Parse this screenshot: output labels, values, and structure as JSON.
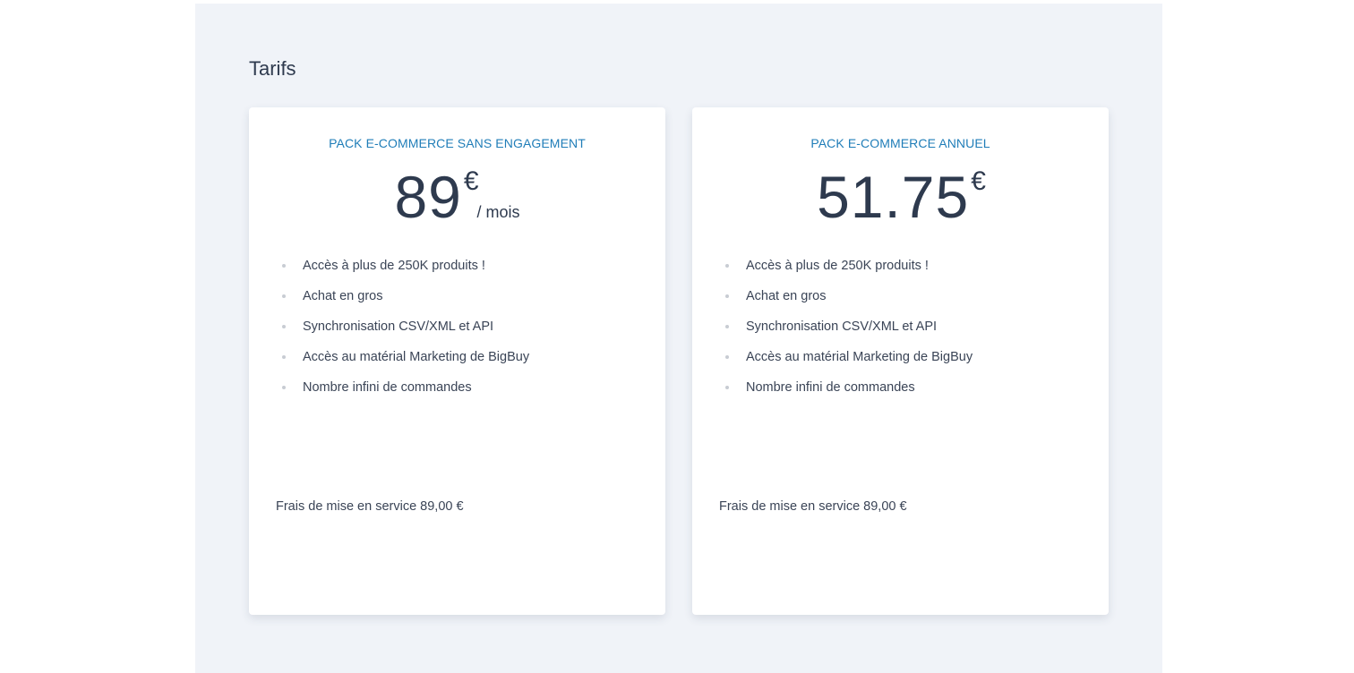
{
  "section": {
    "title": "Tarifs"
  },
  "plans": [
    {
      "name": "PACK E-COMMERCE SANS ENGAGEMENT",
      "price": "89",
      "currency": "€",
      "period": "/ mois",
      "features": [
        "Accès à plus de 250K produits !",
        "Achat en gros",
        "Synchronisation CSV/XML et API",
        "Accès au matérial Marketing de BigBuy",
        "Nombre infini de commandes"
      ],
      "setup_fee": "Frais de mise en service 89,00 €"
    },
    {
      "name": "PACK E-COMMERCE ANNUEL",
      "price": "51.75",
      "currency": "€",
      "period": "",
      "features": [
        "Accès à plus de 250K produits !",
        "Achat en gros",
        "Synchronisation CSV/XML et API",
        "Accès au matérial Marketing de BigBuy",
        "Nombre infini de commandes"
      ],
      "setup_fee": "Frais de mise en service 89,00 €"
    }
  ],
  "colors": {
    "panel_background": "#f0f3f8",
    "plan_name": "#1f7db8",
    "text_dark": "#2e3a4e"
  }
}
